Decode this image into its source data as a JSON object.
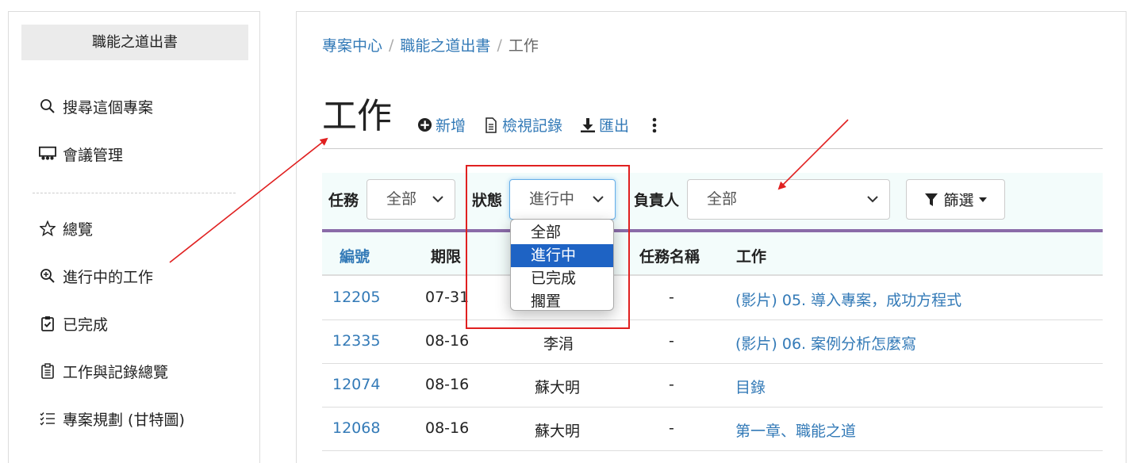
{
  "sidebar": {
    "title": "職能之道出書",
    "items": [
      {
        "label": "搜尋這個專案",
        "icon": "search-icon"
      },
      {
        "label": "會議管理",
        "icon": "meeting-icon"
      },
      {
        "label": "總覽",
        "icon": "star-icon"
      },
      {
        "label": "進行中的工作",
        "icon": "zoom-in-icon"
      },
      {
        "label": "已完成",
        "icon": "clipboard-check-icon"
      },
      {
        "label": "工作與記錄總覽",
        "icon": "clipboard-list-icon"
      },
      {
        "label": "專案規劃 (甘特圖)",
        "icon": "checklist-icon"
      }
    ]
  },
  "breadcrumb": {
    "items": [
      "專案中心",
      "職能之道出書"
    ],
    "current": "工作",
    "separator": "/"
  },
  "page": {
    "title": "工作"
  },
  "toolbar": {
    "add": "新增",
    "view_log": "檢視記錄",
    "export": "匯出"
  },
  "filters": {
    "task_label": "任務",
    "task_value": "全部",
    "status_label": "狀態",
    "status_value": "進行中",
    "owner_label": "負責人",
    "owner_value": "全部",
    "filter_button": "篩選"
  },
  "status_dropdown": {
    "options": [
      "全部",
      "進行中",
      "已完成",
      "擱置"
    ],
    "selected": "進行中"
  },
  "table": {
    "headers": [
      "編號",
      "期限",
      "任務名稱",
      "工作"
    ],
    "rows": [
      {
        "id": "12205",
        "due": "07-31",
        "owner": "",
        "task": "-",
        "work": "(影片) 05. 導入專案，成功方程式"
      },
      {
        "id": "12335",
        "due": "08-16",
        "owner": "李涓",
        "task": "-",
        "work": "(影片) 06. 案例分析怎麼寫"
      },
      {
        "id": "12074",
        "due": "08-16",
        "owner": "蘇大明",
        "task": "-",
        "work": "目錄"
      },
      {
        "id": "12068",
        "due": "08-16",
        "owner": "蘇大明",
        "task": "-",
        "work": "第一章、職能之道"
      }
    ]
  },
  "colors": {
    "link": "#337ab7",
    "accent_rule": "#8a6ba8",
    "filter_bg": "#f3fcfb",
    "dropdown_selected": "#1e63c4",
    "annotation_red": "#e02020"
  }
}
